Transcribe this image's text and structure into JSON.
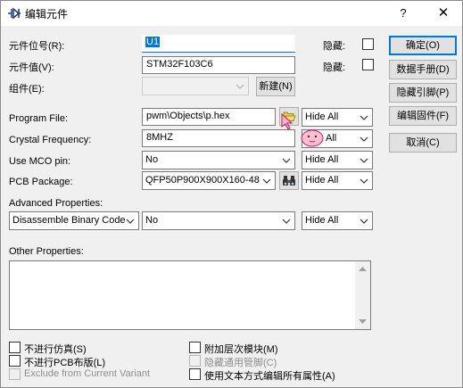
{
  "window": {
    "title": "编辑元件",
    "help_glyph": "?",
    "close_glyph": "✕"
  },
  "fields": {
    "designator_label": "元件位号(R):",
    "designator_value": "U1",
    "value_label": "元件值(V):",
    "value_value": "STM32F103C6",
    "group_label": "组件(E):",
    "group_value": "",
    "new_button": "新建(N)",
    "hide_label_1": "隐藏:",
    "hide_label_2": "隐藏:"
  },
  "props": {
    "program_file_label": "Program File:",
    "program_file_value": "pwm\\Objects\\p.hex",
    "program_file_hide": "Hide All",
    "crystal_label": "Crystal Frequency:",
    "crystal_value": "8MHZ",
    "crystal_hide": "All",
    "mco_label": "Use MCO pin:",
    "mco_value": "No",
    "mco_hide": "Hide All",
    "pcb_label": "PCB Package:",
    "pcb_value": "QFP50P900X900X160-48",
    "pcb_hide": "Hide All",
    "advanced_label": "Advanced Properties:",
    "advanced_prop": "Disassemble Binary Code",
    "advanced_value": "No",
    "advanced_hide": "Hide All",
    "other_label": "Other Properties:"
  },
  "buttons": {
    "ok": "确定(O)",
    "datasheet": "数据手册(D)",
    "hidden_pins": "隐藏引脚(P)",
    "edit_firmware": "编辑固件(F)",
    "cancel": "取消(C)"
  },
  "options": {
    "exclude_sim": "不进行仿真(S)",
    "exclude_pcb": "不进行PCB布版(L)",
    "exclude_variant": "Exclude from Current Variant",
    "attach_hier": "附加层次模块(M)",
    "hide_common_pins": "隐藏通用管脚(C)",
    "edit_as_text": "使用文本方式编辑所有属性(A)"
  },
  "colors": {
    "accent": "#0078d7",
    "face": "#f0f0f0"
  },
  "icons": {
    "app": "component-icon",
    "folder": "folder-open-icon",
    "binoculars": "binoculars-icon",
    "cursor": "pink-pointer-icon"
  }
}
